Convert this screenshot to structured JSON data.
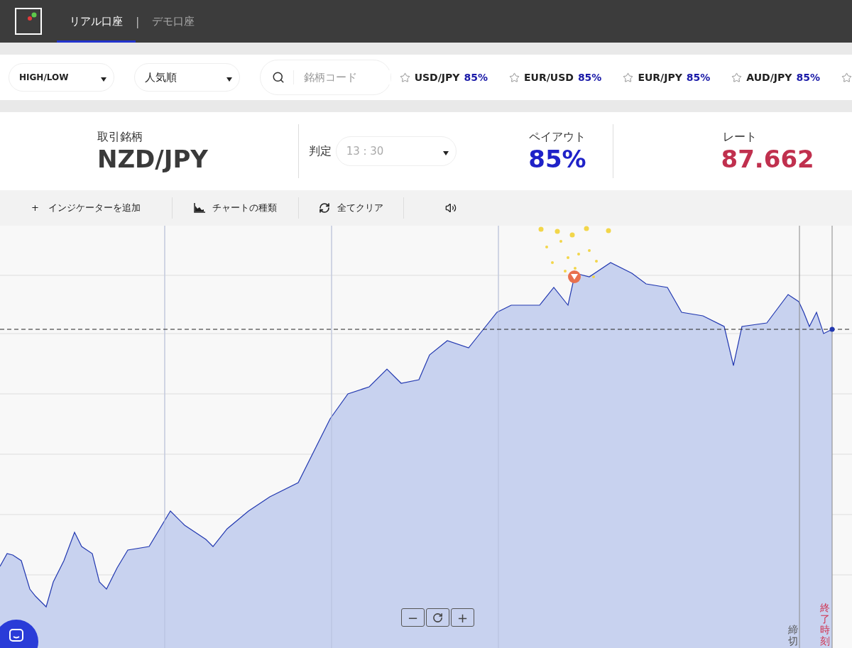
{
  "header": {
    "tabs": [
      {
        "label": "リアル口座",
        "selected": true
      },
      {
        "label": "デモ口座",
        "selected": false
      }
    ],
    "separator": "|"
  },
  "filters": {
    "type_select": "HIGH/LOW",
    "sort_select": "人気順",
    "search": {
      "placeholder": "銘柄コード"
    }
  },
  "favorites": [
    {
      "pair": "USD/JPY",
      "payout": "85%"
    },
    {
      "pair": "EUR/USD",
      "payout": "85%"
    },
    {
      "pair": "EUR/JPY",
      "payout": "85%"
    },
    {
      "pair": "AUD/JPY",
      "payout": "85%"
    }
  ],
  "info": {
    "symbol_label": "取引銘柄",
    "symbol": "NZD/JPY",
    "judge_label": "判定",
    "judge_time": "13 : 30",
    "payout_label": "ペイアウト",
    "payout": "85%",
    "rate_label": "レート",
    "rate": "87.662"
  },
  "toolbar": {
    "add_indicator": "+　インジケーターを追加",
    "chart_type": "チャートの種類",
    "clear_all": "全てクリア"
  },
  "chart": {
    "zoom_out": "−",
    "zoom_in": "+",
    "deadline_label": "締切",
    "end_label": "終了時刻"
  }
}
